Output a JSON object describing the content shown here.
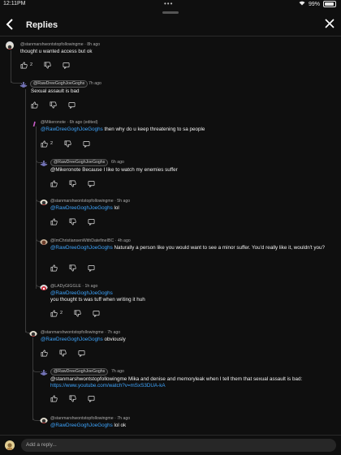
{
  "status": {
    "time": "12:11PM",
    "battery": "99%"
  },
  "header": {
    "title": "Replies"
  },
  "comments": [
    {
      "author": "@stanmarshwontstopfollowingme",
      "age": "8h ago",
      "text": "thought u wanted access but ok",
      "likes": "2"
    },
    {
      "author": "@RawDreeGoghJoeGoghs",
      "age": "7h ago",
      "text": "Sexual assault is bad",
      "likes": ""
    },
    {
      "author": "@Mikeronote",
      "age": "6h ago (edited)",
      "mention": "@RawDreeGoghJoeGoghs",
      "text": " then why do u keep threatening to sa people",
      "likes": "2"
    },
    {
      "author": "@RawDreeGoghJoeGoghs",
      "age": "6h ago",
      "text": "@Mikeronote Because I like to watch my enemies suffer",
      "likes": ""
    },
    {
      "author": "@stanmarshwontstopfollowingme",
      "age": "5h ago",
      "mention": "@RawDreeGoghJoeGoghs",
      "text": " lol",
      "likes": ""
    },
    {
      "author": "@ImChristiansenWithDatefineIBC",
      "age": "4h ago",
      "mention": "@RawDreeGoghJoeGoghs",
      "text": " Naturally a person like you would want to see a minor suffer. You'd really like it, wouldn't you?",
      "likes": ""
    },
    {
      "author": "@LADyGIGGLE",
      "age": "1h ago",
      "mention": "@RawDreeGoghJoeGoghs",
      "text": "you thought ts was tuff when writing it huh",
      "likes": "2"
    },
    {
      "author": "@stanmarshwontstopfollowingme",
      "age": "7h ago",
      "mention": "@RawDreeGoghJoeGoghs",
      "text": " obviously",
      "likes": ""
    },
    {
      "author": "@RawDreeGoghJoeGoghs",
      "age": "7h ago",
      "text": "@stanmarshwontstopfollowingme Mika and denise and memoryleak when I tell them that sexual assault is bad:",
      "link": "https://www.youtube.com/watch?v=mSxS3DUA-kA",
      "likes": ""
    },
    {
      "author": "@stanmarshwontstopfollowingme",
      "age": "7h ago",
      "mention": "@RawDreeGoghJoeGoghs",
      "text": " lol ok",
      "likes": ""
    }
  ],
  "reply_input": {
    "placeholder": "Add a reply..."
  },
  "icons": [
    "back-arrow-icon",
    "close-icon",
    "like-icon",
    "dislike-icon",
    "reply-icon",
    "more-vert-icon"
  ]
}
